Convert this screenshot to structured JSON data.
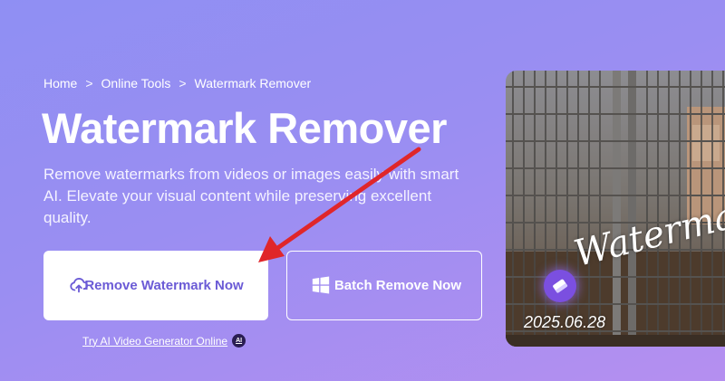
{
  "breadcrumb": {
    "items": [
      "Home",
      "Online Tools",
      "Watermark Remover"
    ],
    "separator": ">"
  },
  "hero": {
    "title": "Watermark Remover",
    "description": "Remove watermarks from videos or images easily with smart AI. Elevate your visual content while preserving excellent quality."
  },
  "buttons": {
    "primary_label": "Remove Watermark Now",
    "primary_icon": "cloud-upload-icon",
    "secondary_label": "Batch Remove Now",
    "secondary_icon": "windows-icon"
  },
  "try_link": {
    "label": "Try AI Video Generator Online",
    "badge": "AI"
  },
  "preview": {
    "watermark_text": "Watermark",
    "date_text": "2025.06.28",
    "tool_icon": "eraser-icon"
  },
  "colors": {
    "accent": "#6b5bd6",
    "arrow": "#e0262a"
  }
}
